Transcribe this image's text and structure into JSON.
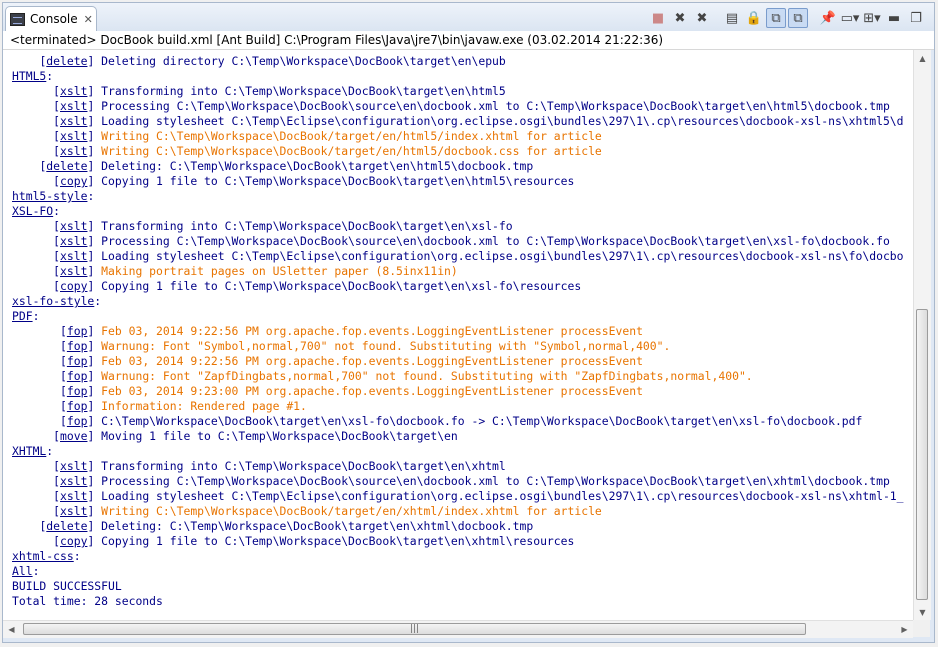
{
  "tab": {
    "label": "Console",
    "close": "✕"
  },
  "toolbar": [
    {
      "name": "terminate-icon",
      "glyph": "■",
      "state": "disabled"
    },
    {
      "name": "remove-launch-icon",
      "glyph": "✖",
      "state": ""
    },
    {
      "name": "remove-all-terminated-icon",
      "glyph": "✖",
      "state": ""
    },
    {
      "name": "sep",
      "glyph": "",
      "state": "sep"
    },
    {
      "name": "clear-console-icon",
      "glyph": "▤",
      "state": ""
    },
    {
      "name": "scroll-lock-icon",
      "glyph": "🔒",
      "state": ""
    },
    {
      "name": "show-on-stdout-icon",
      "glyph": "⧉",
      "state": "pressed"
    },
    {
      "name": "show-on-stderr-icon",
      "glyph": "⧉",
      "state": "pressed"
    },
    {
      "name": "sep",
      "glyph": "",
      "state": "sep"
    },
    {
      "name": "pin-console-icon",
      "glyph": "📌",
      "state": ""
    },
    {
      "name": "display-console-icon",
      "glyph": "▭▾",
      "state": ""
    },
    {
      "name": "open-console-icon",
      "glyph": "⊞▾",
      "state": ""
    },
    {
      "name": "minimize-icon",
      "glyph": "▬",
      "state": ""
    },
    {
      "name": "maximize-icon",
      "glyph": "❐",
      "state": ""
    }
  ],
  "header": "<terminated> DocBook build.xml [Ant Build] C:\\Program Files\\Java\\jre7\\bin\\javaw.exe (03.02.2014 21:22:36)",
  "lines": [
    {
      "indent": "    ",
      "tag": "delete",
      "text": " Deleting directory C:\\Temp\\Workspace\\DocBook\\target\\en\\epub",
      "color": "blue"
    },
    {
      "target": "HTML5"
    },
    {
      "indent": "      ",
      "tag": "xslt",
      "text": " Transforming into C:\\Temp\\Workspace\\DocBook\\target\\en\\html5",
      "color": "blue"
    },
    {
      "indent": "      ",
      "tag": "xslt",
      "text": " Processing C:\\Temp\\Workspace\\DocBook\\source\\en\\docbook.xml to C:\\Temp\\Workspace\\DocBook\\target\\en\\html5\\docbook.tmp",
      "color": "blue"
    },
    {
      "indent": "      ",
      "tag": "xslt",
      "text": " Loading stylesheet C:\\Temp\\Eclipse\\configuration\\org.eclipse.osgi\\bundles\\297\\1\\.cp\\resources\\docbook-xsl-ns\\xhtml5\\d",
      "color": "blue"
    },
    {
      "indent": "      ",
      "tag": "xslt",
      "text": " Writing C:\\Temp\\Workspace\\DocBook/target/en/html5/index.xhtml for article",
      "color": "orange"
    },
    {
      "indent": "      ",
      "tag": "xslt",
      "text": " Writing C:\\Temp\\Workspace\\DocBook/target/en/html5/docbook.css for article",
      "color": "orange"
    },
    {
      "indent": "    ",
      "tag": "delete",
      "text": " Deleting: C:\\Temp\\Workspace\\DocBook\\target\\en\\html5\\docbook.tmp",
      "color": "blue"
    },
    {
      "indent": "      ",
      "tag": "copy",
      "text": " Copying 1 file to C:\\Temp\\Workspace\\DocBook\\target\\en\\html5\\resources",
      "color": "blue"
    },
    {
      "target": "html5-style"
    },
    {
      "target": "XSL-FO"
    },
    {
      "indent": "      ",
      "tag": "xslt",
      "text": " Transforming into C:\\Temp\\Workspace\\DocBook\\target\\en\\xsl-fo",
      "color": "blue"
    },
    {
      "indent": "      ",
      "tag": "xslt",
      "text": " Processing C:\\Temp\\Workspace\\DocBook\\source\\en\\docbook.xml to C:\\Temp\\Workspace\\DocBook\\target\\en\\xsl-fo\\docbook.fo",
      "color": "blue"
    },
    {
      "indent": "      ",
      "tag": "xslt",
      "text": " Loading stylesheet C:\\Temp\\Eclipse\\configuration\\org.eclipse.osgi\\bundles\\297\\1\\.cp\\resources\\docbook-xsl-ns\\fo\\docbo",
      "color": "blue"
    },
    {
      "indent": "      ",
      "tag": "xslt",
      "text": " Making portrait pages on USletter paper (8.5inx11in)",
      "color": "orange"
    },
    {
      "indent": "      ",
      "tag": "copy",
      "text": " Copying 1 file to C:\\Temp\\Workspace\\DocBook\\target\\en\\xsl-fo\\resources",
      "color": "blue"
    },
    {
      "target": "xsl-fo-style"
    },
    {
      "target": "PDF"
    },
    {
      "indent": "       ",
      "tag": "fop",
      "text": " Feb 03, 2014 9:22:56 PM org.apache.fop.events.LoggingEventListener processEvent",
      "color": "orange"
    },
    {
      "indent": "       ",
      "tag": "fop",
      "text": " Warnung: Font \"Symbol,normal,700\" not found. Substituting with \"Symbol,normal,400\".",
      "color": "orange"
    },
    {
      "indent": "       ",
      "tag": "fop",
      "text": " Feb 03, 2014 9:22:56 PM org.apache.fop.events.LoggingEventListener processEvent",
      "color": "orange"
    },
    {
      "indent": "       ",
      "tag": "fop",
      "text": " Warnung: Font \"ZapfDingbats,normal,700\" not found. Substituting with \"ZapfDingbats,normal,400\".",
      "color": "orange"
    },
    {
      "indent": "       ",
      "tag": "fop",
      "text": " Feb 03, 2014 9:23:00 PM org.apache.fop.events.LoggingEventListener processEvent",
      "color": "orange"
    },
    {
      "indent": "       ",
      "tag": "fop",
      "text": " Information: Rendered page #1.",
      "color": "orange"
    },
    {
      "indent": "       ",
      "tag": "fop",
      "text": " C:\\Temp\\Workspace\\DocBook\\target\\en\\xsl-fo\\docbook.fo -> C:\\Temp\\Workspace\\DocBook\\target\\en\\xsl-fo\\docbook.pdf",
      "color": "blue"
    },
    {
      "indent": "      ",
      "tag": "move",
      "text": " Moving 1 file to C:\\Temp\\Workspace\\DocBook\\target\\en",
      "color": "blue"
    },
    {
      "target": "XHTML"
    },
    {
      "indent": "      ",
      "tag": "xslt",
      "text": " Transforming into C:\\Temp\\Workspace\\DocBook\\target\\en\\xhtml",
      "color": "blue"
    },
    {
      "indent": "      ",
      "tag": "xslt",
      "text": " Processing C:\\Temp\\Workspace\\DocBook\\source\\en\\docbook.xml to C:\\Temp\\Workspace\\DocBook\\target\\en\\xhtml\\docbook.tmp",
      "color": "blue"
    },
    {
      "indent": "      ",
      "tag": "xslt",
      "text": " Loading stylesheet C:\\Temp\\Eclipse\\configuration\\org.eclipse.osgi\\bundles\\297\\1\\.cp\\resources\\docbook-xsl-ns\\xhtml-1_",
      "color": "blue"
    },
    {
      "indent": "      ",
      "tag": "xslt",
      "text": " Writing C:\\Temp\\Workspace\\DocBook/target/en/xhtml/index.xhtml for article",
      "color": "orange"
    },
    {
      "indent": "    ",
      "tag": "delete",
      "text": " Deleting: C:\\Temp\\Workspace\\DocBook\\target\\en\\xhtml\\docbook.tmp",
      "color": "blue"
    },
    {
      "indent": "      ",
      "tag": "copy",
      "text": " Copying 1 file to C:\\Temp\\Workspace\\DocBook\\target\\en\\xhtml\\resources",
      "color": "blue"
    },
    {
      "target": "xhtml-css"
    },
    {
      "target": "All"
    },
    {
      "plain": "BUILD SUCCESSFUL"
    },
    {
      "plain": "Total time: 28 seconds"
    }
  ],
  "scroll": {
    "vertical_position": 0.82,
    "horizontal_position": 0.0
  }
}
